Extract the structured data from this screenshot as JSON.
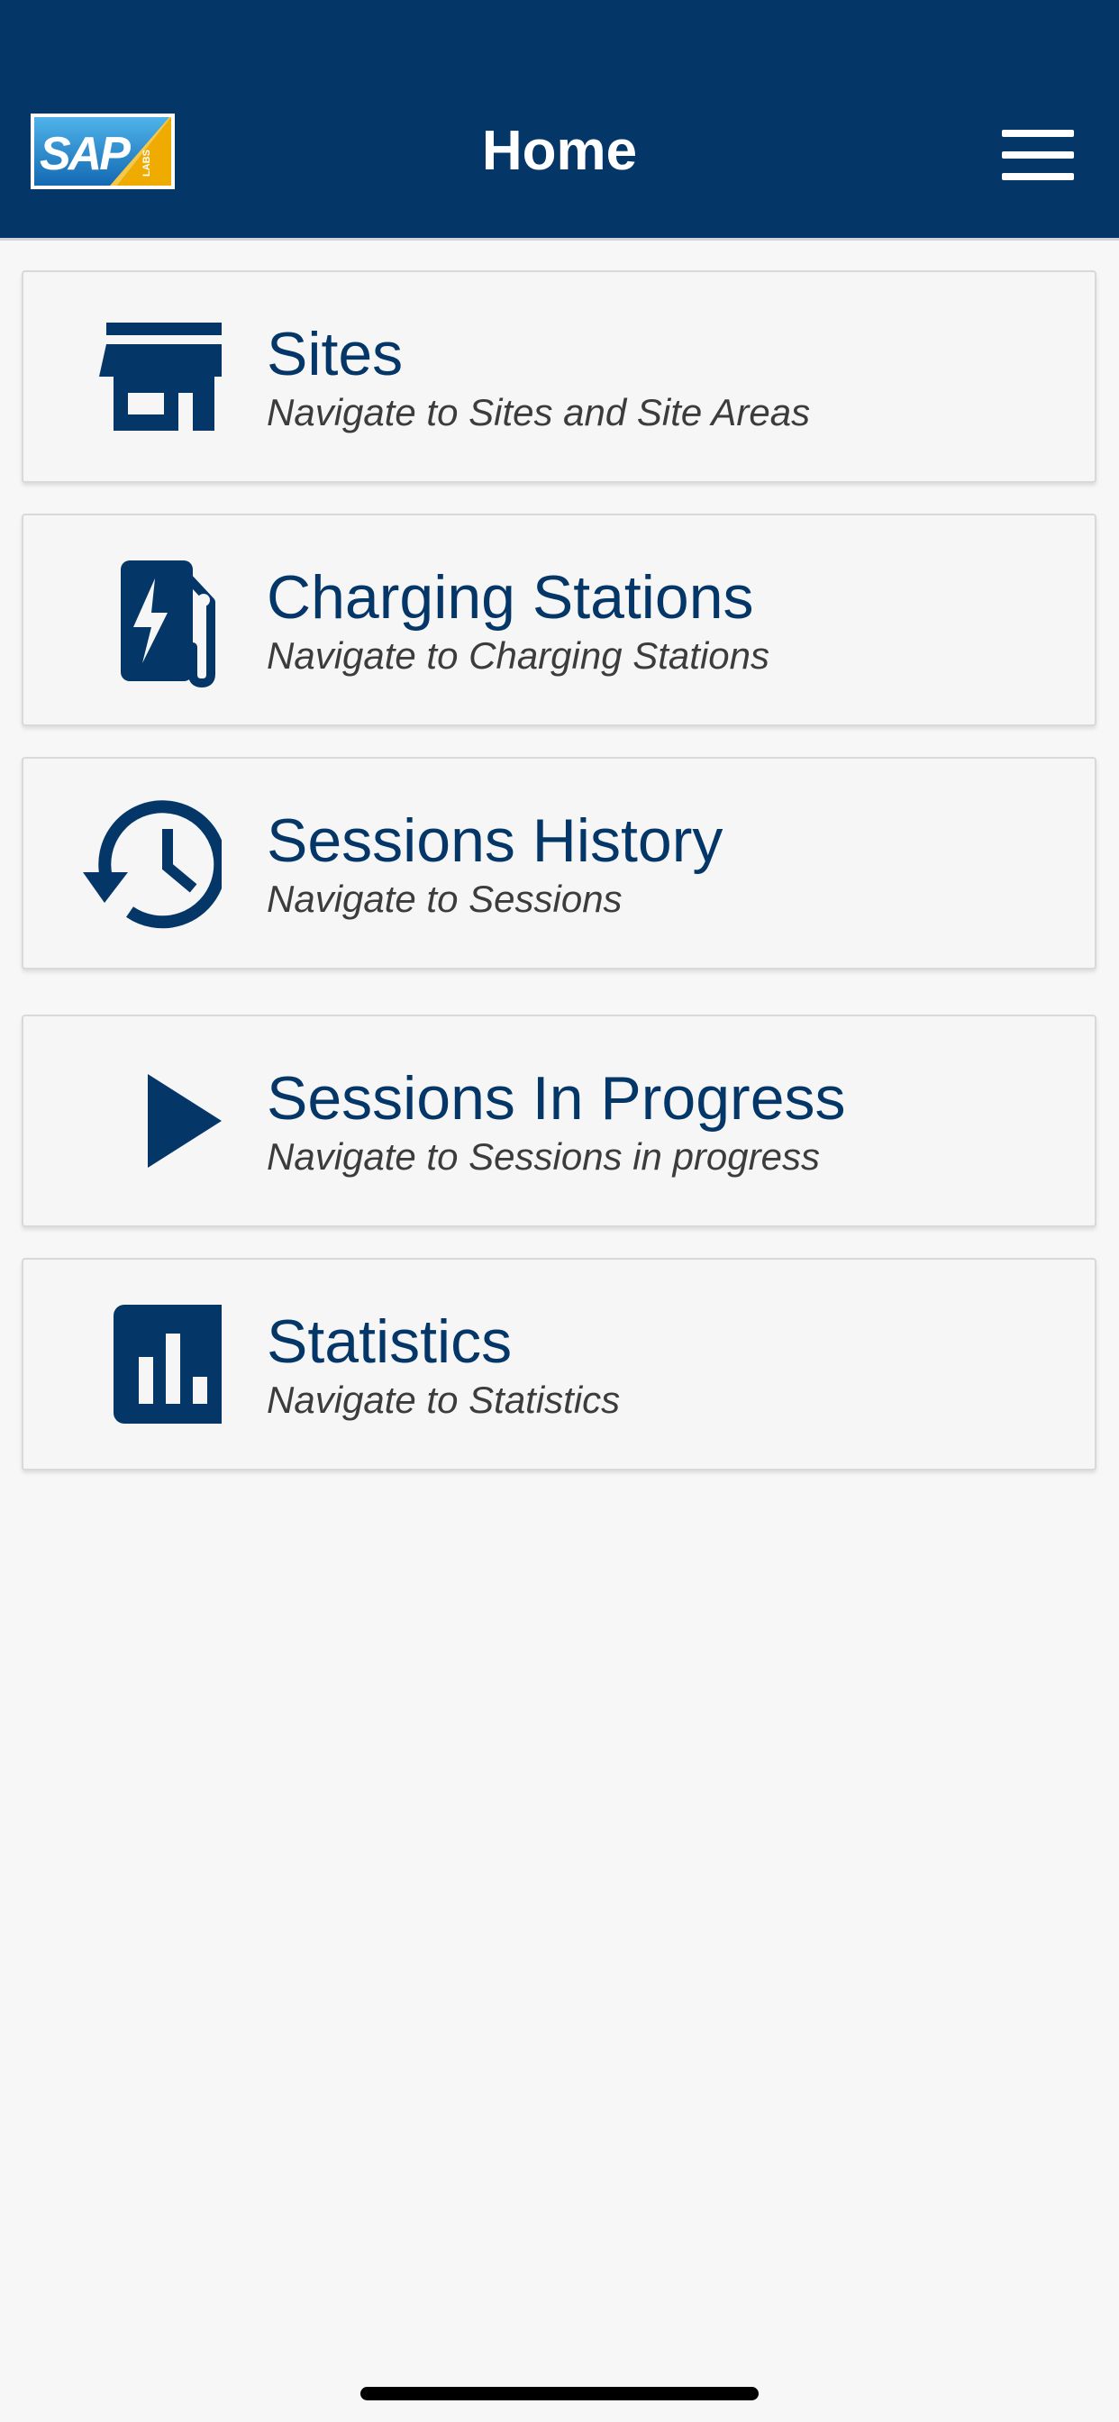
{
  "theme": {
    "header_bg": "#043668",
    "primary": "#043668",
    "background": "#f7f7f7"
  },
  "header": {
    "title": "Home",
    "logo": {
      "icon": "sap-labs-logo",
      "text": "SAP",
      "subtext": "LABS"
    },
    "menu_icon": "hamburger-menu-icon"
  },
  "menu_items": [
    {
      "id": "sites",
      "icon": "store-icon",
      "title": "Sites",
      "subtitle": "Navigate to Sites and Site Areas"
    },
    {
      "id": "charging-stations",
      "icon": "ev-station-icon",
      "title": "Charging Stations",
      "subtitle": "Navigate to Charging Stations"
    },
    {
      "id": "sessions-history",
      "icon": "history-icon",
      "title": "Sessions History",
      "subtitle": "Navigate to Sessions"
    },
    {
      "id": "sessions-in-progress",
      "icon": "play-icon",
      "title": "Sessions In Progress",
      "subtitle": "Navigate to Sessions in progress"
    },
    {
      "id": "statistics",
      "icon": "bar-chart-icon",
      "title": "Statistics",
      "subtitle": "Navigate to Statistics"
    }
  ]
}
